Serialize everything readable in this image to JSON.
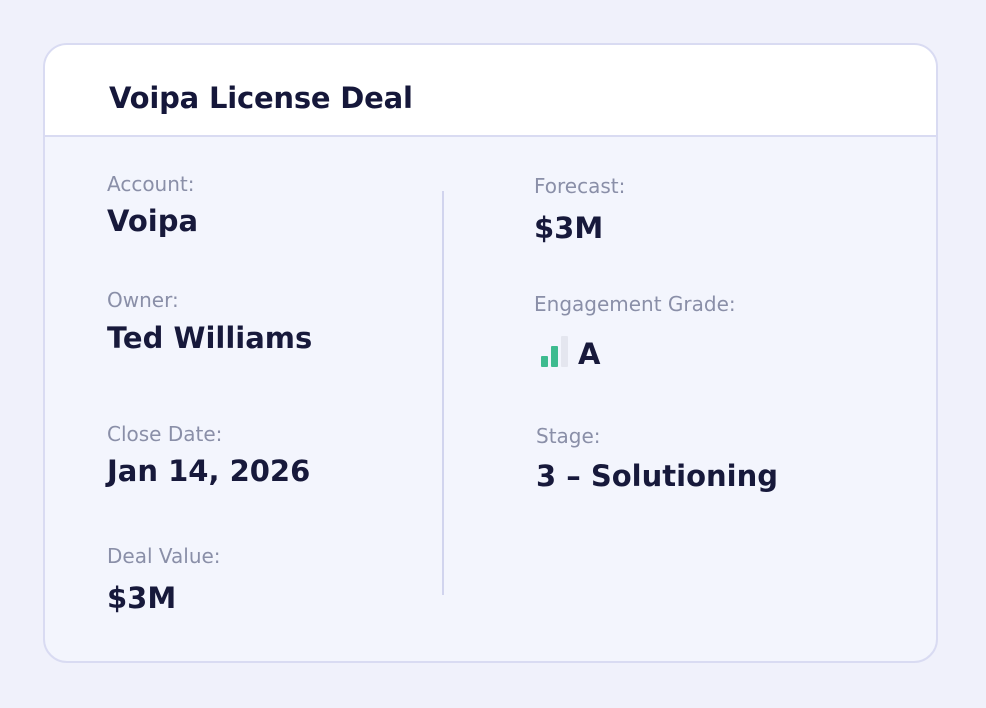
{
  "deal": {
    "title": "Voipa License Deal"
  },
  "left_fields": {
    "account": {
      "label": "Account:",
      "value": "Voipa"
    },
    "owner": {
      "label": "Owner:",
      "value": "Ted Williams"
    },
    "close_date": {
      "label": "Close Date:",
      "value": "Jan 14, 2026"
    },
    "deal_value": {
      "label": "Deal Value:",
      "value": "$3M"
    }
  },
  "right_fields": {
    "forecast": {
      "label": "Forecast:",
      "value": "$3M"
    },
    "engagement_grade": {
      "label": "Engagement Grade:",
      "value": "A",
      "icon": "signal-bars-icon",
      "filled_bars": 2,
      "total_bars": 3,
      "colors": {
        "filled": "#3dbb8f",
        "empty": "#e4e6ef"
      }
    },
    "stage": {
      "label": "Stage:",
      "value": "3 – Solutioning"
    }
  },
  "colors": {
    "background": "#f0f1fb",
    "card_border": "#d9dbf2",
    "card_body": "#f3f5fd",
    "header_bg": "#ffffff",
    "label_text": "#8a8fa8",
    "value_text": "#17193b",
    "divider": "#d1d4ee"
  }
}
